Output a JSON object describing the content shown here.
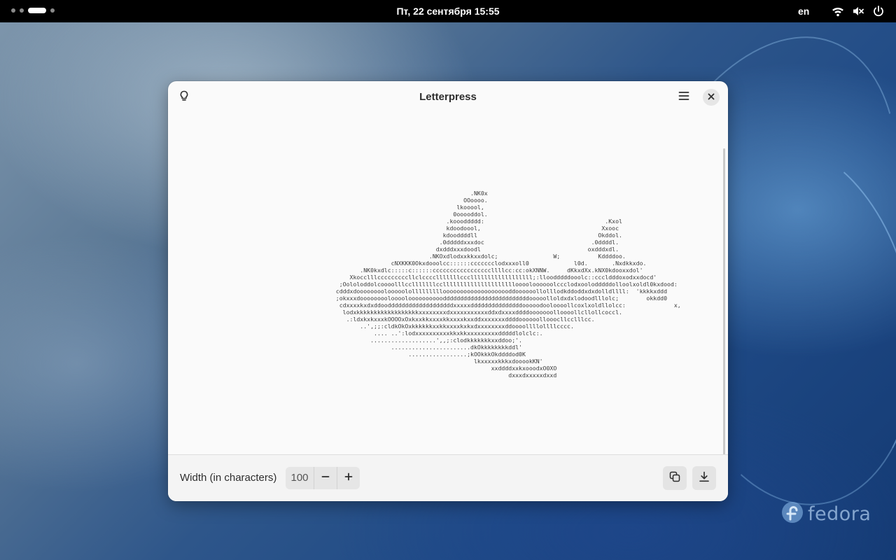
{
  "topbar": {
    "clock": "Пт, 22 сентября  15:55",
    "language": "en",
    "icons": [
      "wifi-icon",
      "volume-muted-icon",
      "power-icon"
    ]
  },
  "window": {
    "title": "Letterpress",
    "header_icons": [
      "lightbulb-icon",
      "hamburger-menu-icon",
      "close-icon"
    ],
    "ascii_art": "                                                        .NK0x\n                                                      OOoooo.\n                                                    lkooool,\n                                                   0ooooddol.\n                                                 .koooddddd:                                   .Kxol\n                                                 kdoodoool,                                   Xxooc\n                                                kdooddddll                                   Okddol.\n                                               .0dddddxxxdoc                               .0ddddl.\n                                              dxdddxxxdoodl                               oxdddxdl.\n                                            .NKOxdlodxxkkxxdolc;                W;           Kddddoo.\n                                 cNXKKK0Okxdooolcc::::::ccccccclodxxxoll0             l0d.       .Nxdkkxdo.\n                        .NK0kxdlc:::::c::::::cccccccccccccccccllllcc:cc:okXNNW.     dKkxdXx.kNX0kdooxxdol'\n                     Xkocclllcccccccccllclcccclllllllcccllllllllllllllllll;:lloodddddooolc::cccldddoxodxxdocd'\n                  ;Oololoddolcoooolllcclllllllcclllllllllllllllllllllooooloooooolccclodxoolodddddolloolxoldl0kxdood:\n                 cdddxdoooooooolooooolollllllllloooooooooooooooooooddoooooollolllodkddoddxdxdolldllll:  'kkkkxddd\n                 ;okxxxdoooooooolooooloooooooooodddddddddddddddddddddddddooooolloldxdxlodoodlllolc;        okkdd0\n                  cdxxxxkxdxddoodddddddddddddddddddxxxxxdddddddddddddddooooodooloooollcoxlxoldllolcc:              x,\n                   lodxkkkkkkkkkkkkkkkkkkxxxxxxxxdxxxxxxxxxxxddxdxxxxddddooooooolloooollcllollcoccl.\n                    .:ldxkxkxxxkOOOOxOxkxxkkxxxxkkxxxxkxxddxxxxxxxddddoooooollooocllcclllcc.\n                        ..',;;:cldkOkOxkkkkkkxxkkxxxxkxkxdxxxxxxxxddoooollllollllcccc.\n                            .... ..':lodxxxxxxxxxxkkxkkxxxxxxxxxdddddlolclc:.\n                           ...................',,;:clodkkkkkkkxxddoo;'.\n                                 .......................dkOkkkkkkkkddl'\n                                      .................;kOOkkkOkddddod0K\n                                                         lkxxxxxkkkxdooookKN'\n                                                              xxddddxxkxooodxO0XO\n                                                                   dxxxdxxxxxdxxd"
  },
  "bottom": {
    "width_label": "Width (in characters)",
    "width_value": "100",
    "icons": [
      "minus-icon",
      "plus-icon",
      "copy-icon",
      "download-icon"
    ]
  },
  "desktop": {
    "brand": "fedora"
  }
}
